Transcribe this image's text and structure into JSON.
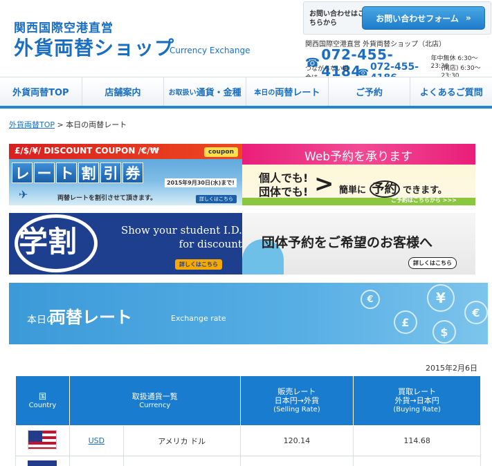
{
  "header": {
    "brand_top": "関西国際空港直営",
    "brand_main": "外貨両替ショップ",
    "brand_en": "Currency Exchange",
    "inquiry_text": "お問い合わせはこちらから",
    "inquiry_button": "お問い合わせフォーム",
    "inquiry_button_arrow": "»",
    "shop_name": "関西国際空港直営 外貨両替ショップ（北店）",
    "phone_main": "072-455-4184",
    "phone_main_hours": "年中無休 6:30〜23:30",
    "phone_sub_note": "つながらない場合は",
    "phone_sub": "072-455-4186",
    "phone_sub_hours": "(南店) 6:30〜23:30",
    "phone_icon": "☎"
  },
  "nav": {
    "items": [
      {
        "label": "外貨両替TOP"
      },
      {
        "label": "店舗案内"
      },
      {
        "prefix": "お取扱い",
        "label": "通貨・金種"
      },
      {
        "prefix": "本日の",
        "label": "両替レート"
      },
      {
        "label": "ご予約"
      },
      {
        "label": "よくあるご質問"
      }
    ]
  },
  "breadcrumb": {
    "home": "外貨両替TOP",
    "separator": ">",
    "current": "本日の両替レート"
  },
  "banners": {
    "coupon": {
      "strip": "£/$/¥/ DISCOUNT COUPON /€/₩",
      "tag": "coupon",
      "title_chars": [
        "レ",
        "ー",
        "ト",
        "割",
        "引",
        "券"
      ],
      "date": "2015年9月30日(水)まで!",
      "desc": "両替レートを割引させて頂きます。",
      "more": "詳しくはこちら"
    },
    "web": {
      "band": "Web予約を承ります",
      "left_line1": "個人でも!",
      "left_line2": "団体でも!",
      "arrow": ">",
      "right_pre": "簡単に",
      "right_big": "予約",
      "right_post": "できます。",
      "footer_btn": "ご予約はこちらから >>>"
    },
    "student": {
      "kanji": "学割",
      "en_line1": "Show your student I.D.",
      "en_line2": "for discount",
      "more": "詳しくはこちら"
    },
    "group": {
      "title": "団体予約をご希望のお客様へ",
      "more": "詳しくはこちら"
    },
    "rate_header": {
      "small": "本日の",
      "big": "両替レート",
      "en": "Exchange rate",
      "coin_symbols": [
        "¥",
        "€",
        "£",
        "$",
        "€"
      ]
    }
  },
  "rates": {
    "date": "2015年2月6日",
    "headers": {
      "country_jp": "国",
      "country_en": "Country",
      "currency_jp": "取扱通貨一覧",
      "currency_en": "Currency",
      "sell_jp1": "販売レート",
      "sell_jp2": "日本円→外貨",
      "sell_en": "(Selling Rate)",
      "buy_jp1": "買取レート",
      "buy_jp2": "外貨→日本円",
      "buy_en": "(Buying Rate)"
    },
    "rows": [
      {
        "flag": "us-flag",
        "code": "USD",
        "name": "アメリカ ドル",
        "sell": "120.14",
        "buy": "114.68"
      }
    ]
  }
}
